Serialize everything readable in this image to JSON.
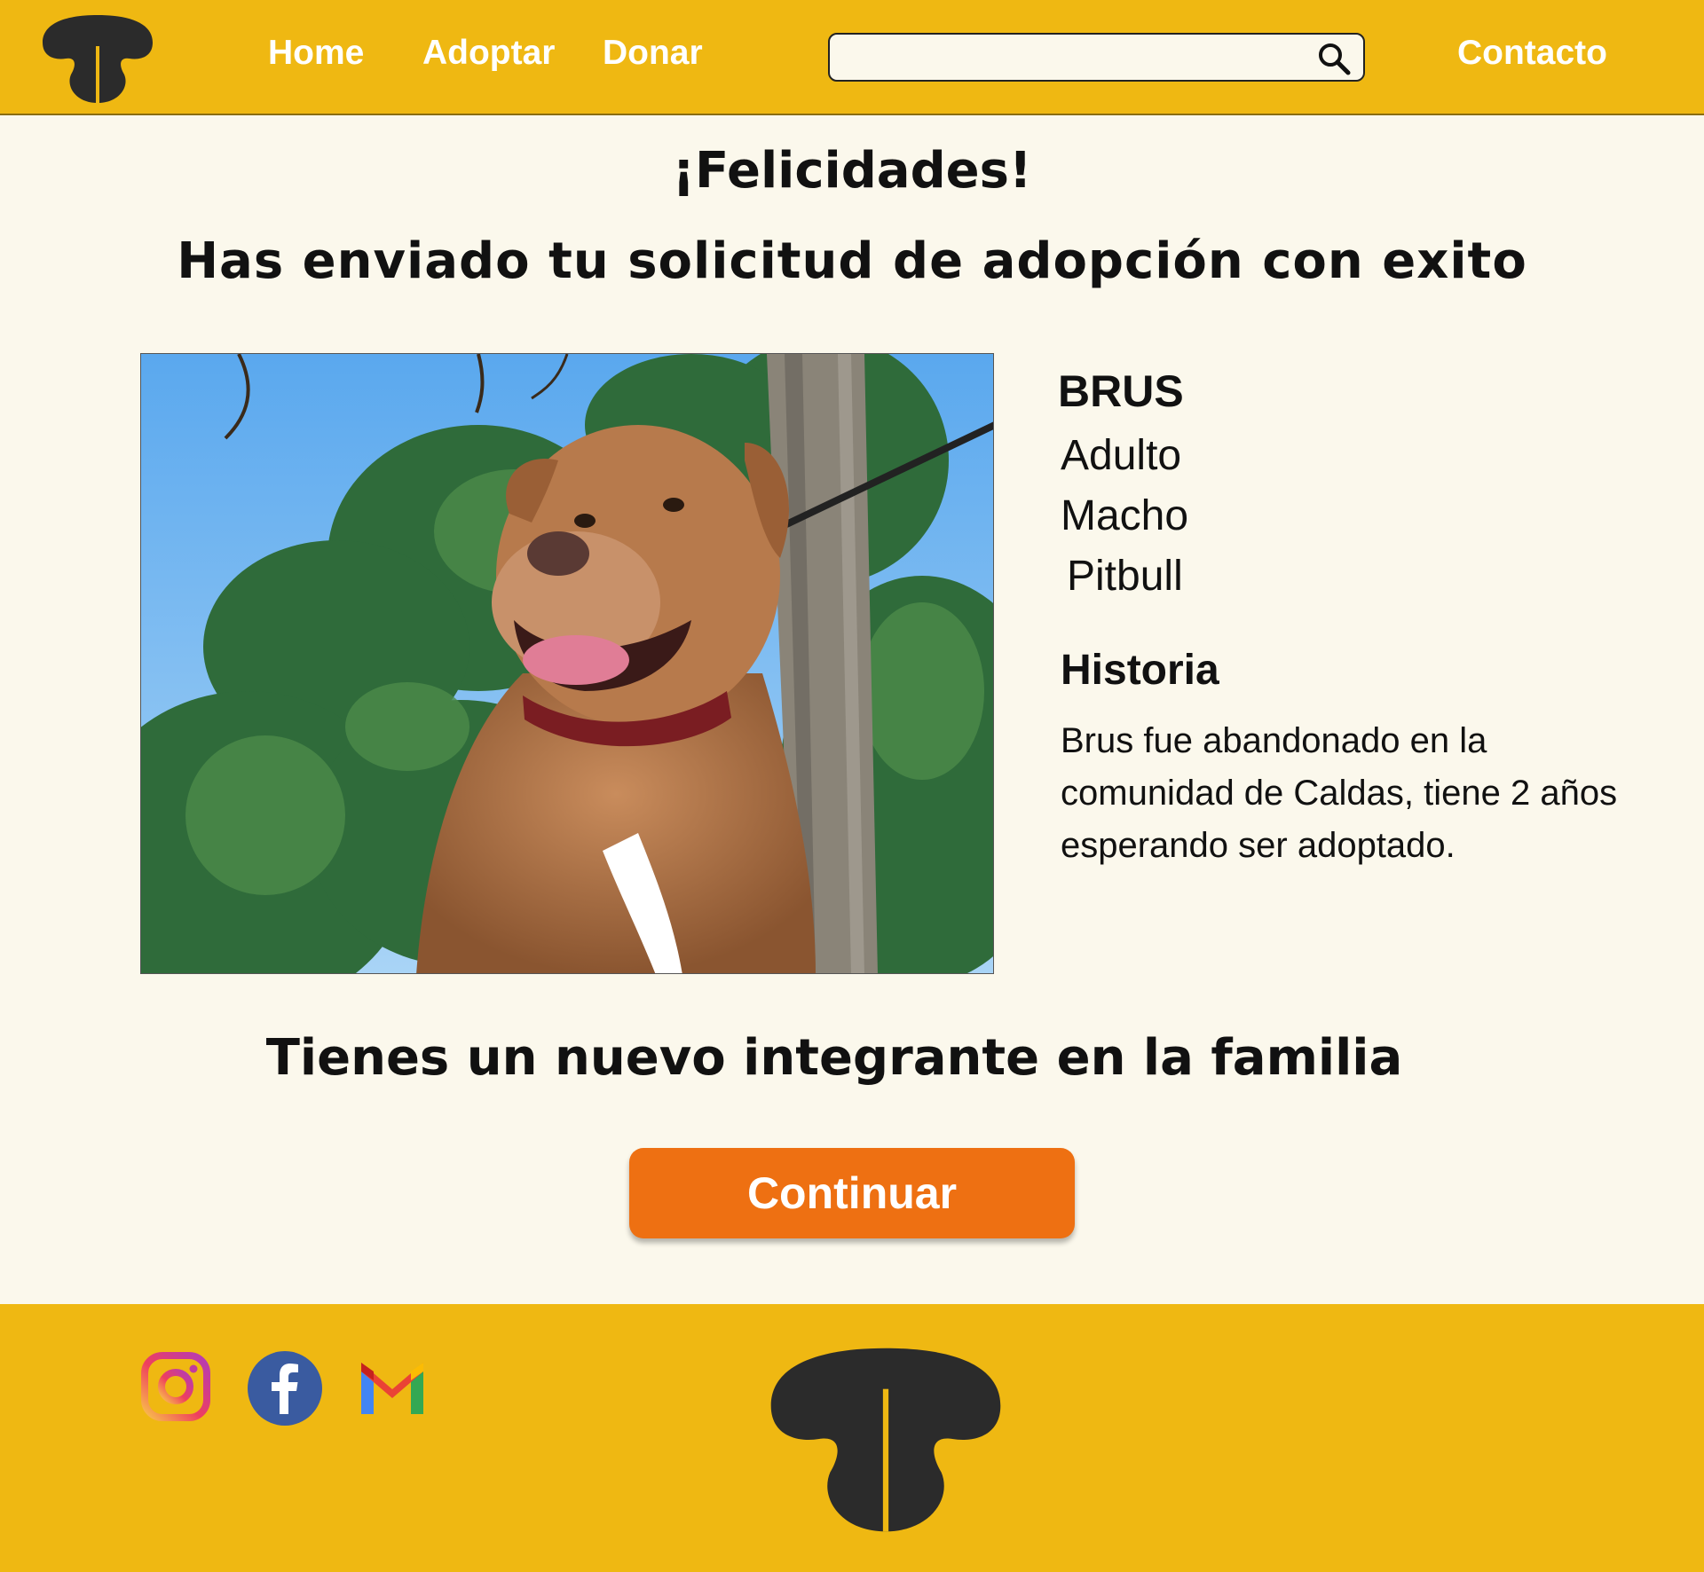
{
  "header": {
    "nav": {
      "home": "Home",
      "adopt": "Adoptar",
      "donate": "Donar",
      "contact": "Contacto"
    },
    "search": {
      "placeholder": "",
      "value": ""
    },
    "logo_icon": "dog-nose-icon",
    "search_icon": "search-icon"
  },
  "main": {
    "title": "¡Felicidades!",
    "subtitle": "Has enviado tu solicitud de adopción con exito",
    "pet": {
      "name": "BRUS",
      "age": "Adulto",
      "sex": "Macho",
      "breed": "Pitbull",
      "story_title": "Historia",
      "story": "Brus fue abandonado en la comunidad de Caldas, tiene 2 años esperando ser adoptado."
    },
    "family_message": "Tienes un nuevo integrante en la familia",
    "continue_label": "Continuar"
  },
  "footer": {
    "social": [
      "instagram-icon",
      "facebook-icon",
      "gmail-icon"
    ]
  },
  "colors": {
    "brand_yellow": "#efb812",
    "background": "#fbf8ec",
    "button_orange": "#ee7012",
    "logo_dark": "#2b2b2b"
  }
}
